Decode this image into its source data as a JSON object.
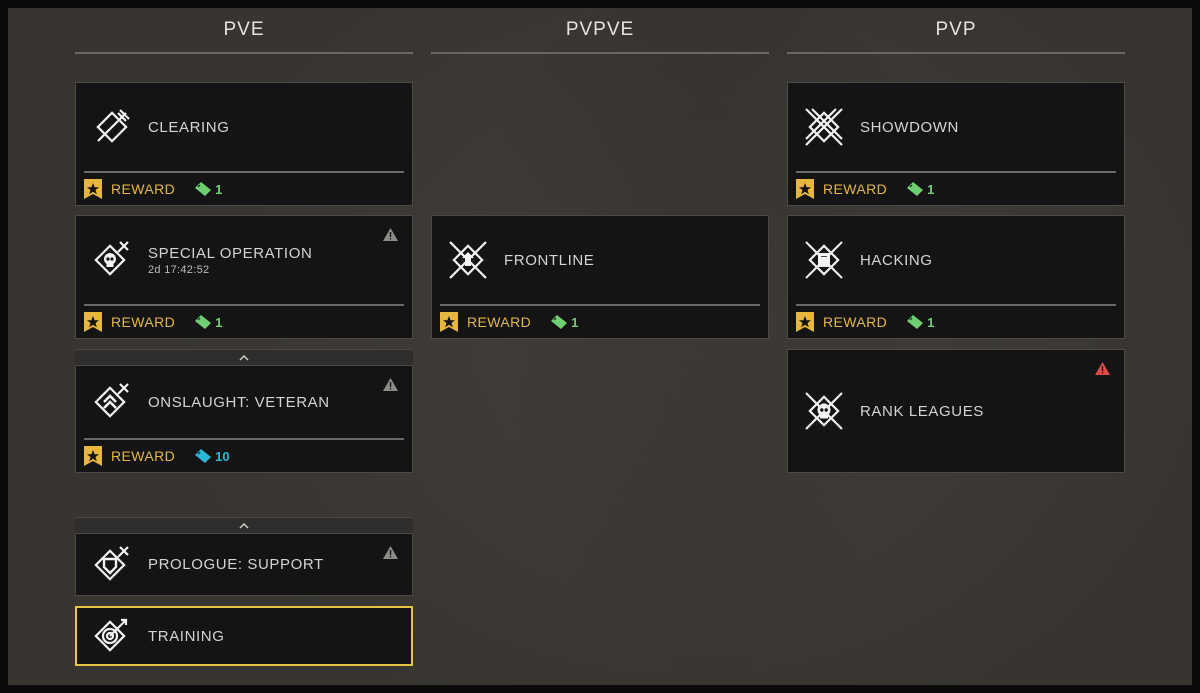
{
  "columns": [
    {
      "title": "PVE"
    },
    {
      "title": "PVPVE"
    },
    {
      "title": "PVP"
    }
  ],
  "reward_label": "REWARD",
  "colors": {
    "reward": "#e5b740",
    "ticket_green": "#6fd072",
    "ticket_blue": "#2cb6d6",
    "warning_gray": "#8e8c89",
    "warning_red": "#e04a4a",
    "selected_border": "#e7c544"
  },
  "pve": {
    "clearing": {
      "name": "CLEARING",
      "icon": "crossed-swords-icon",
      "ticket_count": "1"
    },
    "special_operation": {
      "name": "SPECIAL OPERATION",
      "timer": "2d 17:42:52",
      "icon": "skull-swords-icon",
      "ticket_count": "1"
    },
    "onslaught": {
      "name": "ONSLAUGHT: VETERAN",
      "icon": "chevron-rank-icon",
      "ticket_count": "10"
    },
    "prologue": {
      "name": "PROLOGUE: SUPPORT",
      "icon": "shield-swords-icon"
    },
    "training": {
      "name": "TRAINING",
      "icon": "target-icon"
    }
  },
  "pvpve": {
    "frontline": {
      "name": "FRONTLINE",
      "icon": "frontline-swords-icon",
      "ticket_count": "1"
    }
  },
  "pvp": {
    "showdown": {
      "name": "SHOWDOWN",
      "icon": "multi-swords-icon",
      "ticket_count": "1"
    },
    "hacking": {
      "name": "HACKING",
      "icon": "calculator-swords-icon",
      "ticket_count": "1"
    },
    "rank_leagues": {
      "name": "RANK LEAGUES",
      "icon": "skull-swords-icon"
    }
  }
}
